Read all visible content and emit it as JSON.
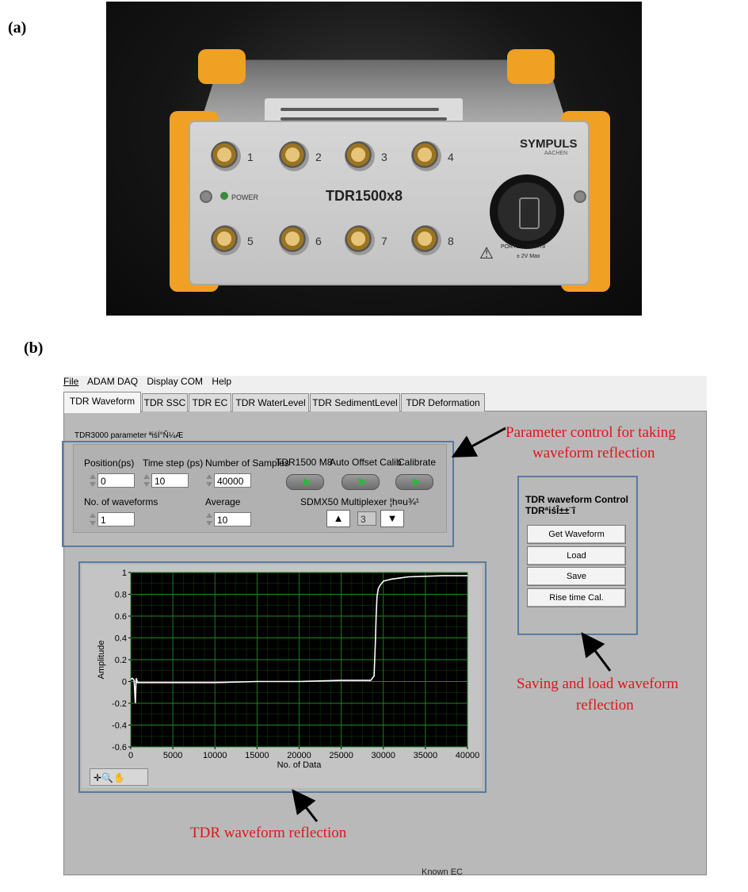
{
  "figure": {
    "label_a": "(a)",
    "label_b": "(b)"
  },
  "device": {
    "model": "TDR1500x8",
    "brand": "SYMPULS",
    "brand_sub": "AACHEN",
    "power_label": "POWER",
    "port_range": "PORT1 ... PORT8",
    "port_max": "± 2V Max",
    "connectors": [
      "1",
      "2",
      "3",
      "4",
      "5",
      "6",
      "7",
      "8"
    ]
  },
  "menu": {
    "items": [
      "File",
      "ADAM DAQ",
      "Display COM",
      "Help"
    ]
  },
  "tabs": [
    {
      "label": "TDR Waveform",
      "active": true
    },
    {
      "label": "TDR SSC",
      "active": false
    },
    {
      "label": "TDR EC",
      "active": false
    },
    {
      "label": "TDR WaterLevel",
      "active": false
    },
    {
      "label": "TDR SedimentLevel",
      "active": false
    },
    {
      "label": "TDR Deformation",
      "active": false
    }
  ],
  "params": {
    "section_title": "TDR3000 parameter ªiśÍ°Ñ¼Æ",
    "position_label": "Position(ps)",
    "position_value": "0",
    "timestep_label": "Time step (ps)",
    "timestep_value": "10",
    "samples_label": "Number of Samples",
    "samples_value": "40000",
    "m8_label": "TDR1500 M8",
    "autooffset_label": "Auto Offset Calib",
    "calibrate_label": "Calibrate",
    "waveforms_label": "No. of waveforms",
    "waveforms_value": "1",
    "average_label": "Average",
    "average_value": "10",
    "mux_label": "SDMX50 Multiplexer ¦h¤u¾¹",
    "mux_value": "3",
    "mux_up": "▲",
    "mux_down": "▼"
  },
  "control": {
    "title": "TDR waveform Control",
    "subtitle": "TDRªiśÎ±±¨î",
    "buttons": [
      "Get Waveform",
      "Load",
      "Save",
      "Rise time Cal."
    ]
  },
  "graph_tools": "✛🔍✋",
  "status": {
    "known_ec": "Known EC"
  },
  "annotations": {
    "param_line1": "Parameter control for taking",
    "param_line2": "waveform reflection",
    "save_line1": "Saving and load waveform",
    "save_line2": "reflection",
    "waveform": "TDR waveform reflection"
  },
  "colors": {
    "plot_bg": "#000000",
    "grid": "#1f8a1f",
    "trace": "#ffffff",
    "annotation_text": "#e0151a",
    "annotation_box": "#5b7a9f",
    "led_green": "#2db83c"
  },
  "chart_data": {
    "type": "line",
    "title": "",
    "xlabel": "No. of Data",
    "ylabel": "Amplitude",
    "xlim": [
      0,
      40000
    ],
    "ylim": [
      -0.6,
      1
    ],
    "x_ticks": [
      0,
      5000,
      10000,
      15000,
      20000,
      25000,
      30000,
      35000,
      40000
    ],
    "y_ticks": [
      -0.6,
      -0.4,
      -0.2,
      0,
      0.2,
      0.4,
      0.6,
      0.8,
      1
    ],
    "y_tick_labels": [
      "-0.6",
      "-0.4",
      "-0.2",
      "0",
      "0.2",
      "0.4",
      "0.6",
      "0.8",
      "1"
    ],
    "grid": true,
    "series": [
      {
        "x": [
          0,
          200,
          400,
          550,
          650,
          800,
          1200,
          2000,
          5000,
          10000,
          15000,
          20000,
          25000,
          28500,
          28900,
          29050,
          29150,
          29250,
          29400,
          29600,
          29800,
          30000,
          30500,
          31000,
          32000,
          33000,
          35000,
          37000,
          40000
        ],
        "y": [
          0.02,
          0.03,
          0.01,
          -0.2,
          0.03,
          -0.01,
          -0.01,
          -0.01,
          -0.01,
          -0.01,
          0.0,
          0.0,
          0.01,
          0.01,
          0.05,
          0.35,
          0.6,
          0.78,
          0.85,
          0.88,
          0.9,
          0.92,
          0.93,
          0.94,
          0.95,
          0.96,
          0.965,
          0.97,
          0.97
        ]
      }
    ]
  }
}
